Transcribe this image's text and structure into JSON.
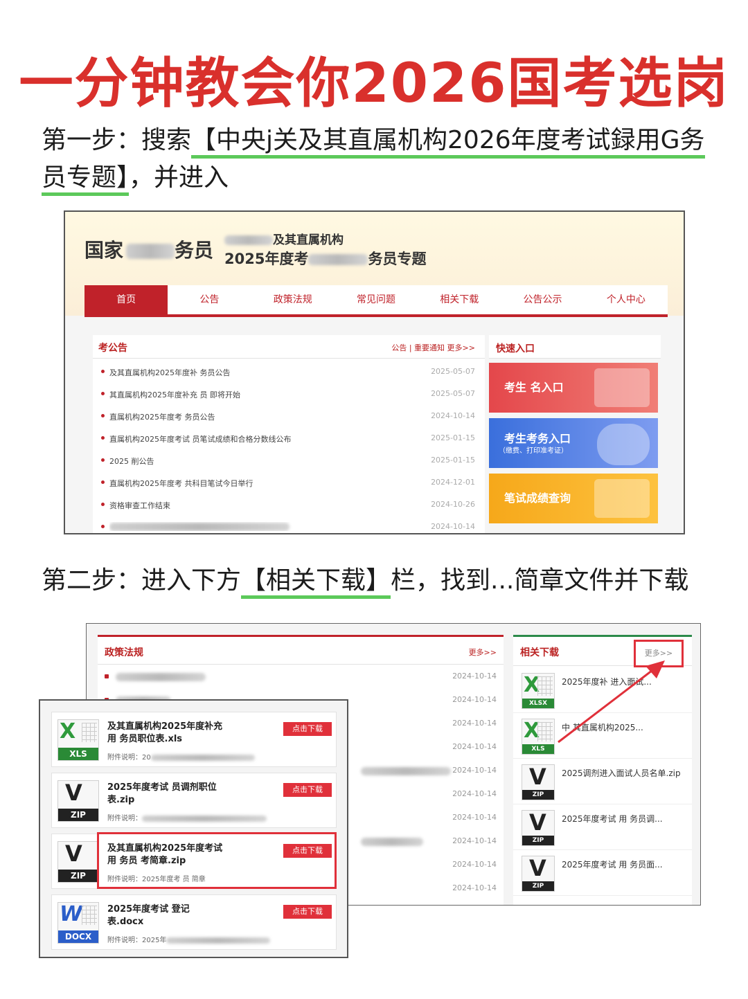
{
  "title": "一分钟教会你2026国考选岗",
  "step1": {
    "prefix": "第一步：搜索",
    "highlight_a": "【中央j关及其直属机构2026年度考试録用G务",
    "highlight_b": "员专题】",
    "suffix": "，并进入"
  },
  "step2": {
    "prefix": "第二步：进入下方",
    "highlight": "【相关下载】",
    "suffix": "栏，找到...简章文件并下载"
  },
  "shot1": {
    "logo_a": "国家",
    "logo_b": "务员",
    "sub1": "及其直属机构",
    "sub2_a": "2025年度考",
    "sub2_b": "务员专题",
    "nav": [
      "首页",
      "公告",
      "政策法规",
      "常见问题",
      "相关下载",
      "公告公示",
      "个人中心"
    ],
    "news_title": "考公告",
    "news_more": "公告 | 重要通知   更多>>",
    "news": [
      {
        "text": "及其直属机构2025年度补     务员公告",
        "date": "2025-05-07"
      },
      {
        "text": "其直属机构2025年度补充     员     即将开始",
        "date": "2025-05-07"
      },
      {
        "text": "直属机构2025年度考     务员公告",
        "date": "2024-10-14"
      },
      {
        "text": "直属机构2025年度考试     员笔试成绩和合格分数线公布",
        "date": "2025-01-15"
      },
      {
        "text": "2025     削公告",
        "date": "2025-01-15"
      },
      {
        "text": "直属机构2025年度考     共科目笔试今日举行",
        "date": "2024-12-01"
      },
      {
        "text": "资格审查工作结束",
        "date": "2024-10-26"
      },
      {
        "text": "",
        "date": "2024-10-14"
      }
    ],
    "quick_title": "快速入口",
    "quick": [
      {
        "label": "考生   名入口",
        "sub": ""
      },
      {
        "label": "考生考务入口",
        "sub": "（缴费、打印准考证）"
      },
      {
        "label": "笔试成绩查询",
        "sub": ""
      }
    ]
  },
  "shot2": {
    "law_title": "政策法规",
    "law_more": "更多>>",
    "law_dates": [
      "2024-10-14",
      "2024-10-14",
      "2024-10-14",
      "2024-10-14",
      "2024-10-14",
      "2024-10-14",
      "2024-10-14",
      "2024-10-14",
      "2024-10-14",
      "2024-10-14"
    ],
    "dl_title": "相关下载",
    "dl_more": "更多>>",
    "downloads": [
      {
        "type": "XLSX",
        "name": "2025年度补     进入面试..."
      },
      {
        "type": "XLS",
        "name": "中     其直属机构2025..."
      },
      {
        "type": "ZIP",
        "name": "2025调剂进入面试人员名单.zip"
      },
      {
        "type": "ZIP",
        "name": "2025年度考试     用     务员调..."
      },
      {
        "type": "ZIP",
        "name": "2025年度考试     用     务员面..."
      }
    ]
  },
  "shot3": {
    "button": "点击下载",
    "cards": [
      {
        "type": "XLS",
        "name_a": "及其直属机构2025年度补充",
        "name_b": "用     务员职位表.xls",
        "note": "附件说明：20"
      },
      {
        "type": "ZIP",
        "name_a": "2025年度考试     员调剂职位",
        "name_b": "表.zip",
        "note": "附件说明："
      },
      {
        "type": "ZIP",
        "name_a": "及其直属机构2025年度考试",
        "name_b": "用     务员     考简章.zip",
        "note": "附件说明：2025年度考     员     简章"
      },
      {
        "type": "DOCX",
        "name_a": "2025年度考试     登记",
        "name_b": "表.docx",
        "note": "附件说明：2025年"
      }
    ]
  },
  "colors": {
    "title_red": "#d9302c",
    "highlight_green": "#5cc95a",
    "site_red": "#c0222a",
    "box_red": "#e0303a"
  }
}
